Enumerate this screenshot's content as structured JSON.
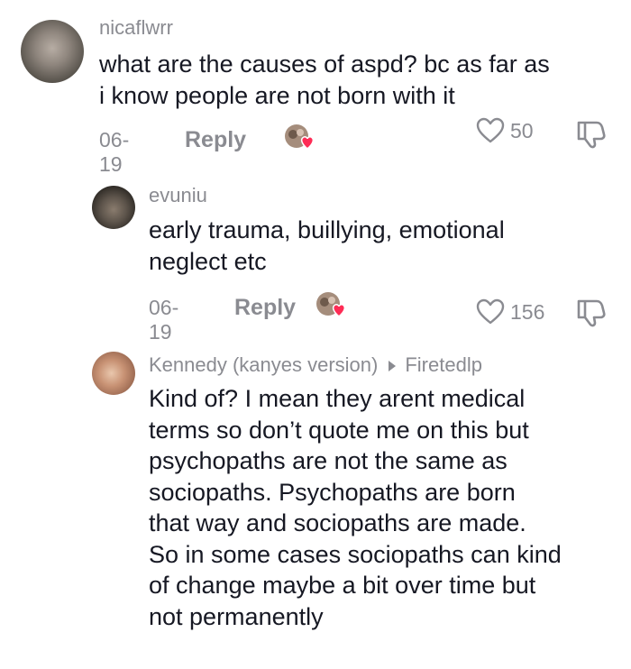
{
  "comments": [
    {
      "username": "nicaflwrr",
      "lines": [
        "what are the causes of aspd? bc as far as",
        "i know people are not born with it"
      ],
      "date": "06-19",
      "reply_label": "Reply",
      "likes": "50"
    },
    {
      "username": "evuniu",
      "lines": [
        "early trauma, buillying, emotional",
        "neglect etc"
      ],
      "date": "06-19",
      "reply_label": "Reply",
      "likes": "156"
    },
    {
      "username": "Kennedy (kanyes version)",
      "reply_to": "Firetedlp",
      "lines": [
        "Kind of? I mean they arent medical",
        "terms so don’t quote me on this but",
        "psychopaths are not the same as",
        "sociopaths. Psychopaths are born",
        "that way and sociopaths are made.",
        "So in some cases sociopaths can kind",
        "of change maybe a bit over time but",
        "not permanently"
      ]
    }
  ],
  "icons": {
    "like": "heart-outline-icon",
    "dislike": "thumbs-down-icon",
    "creator_liked": "creator-liked-avatar-heart-icon",
    "reply_arrow": "triangle-right-icon"
  },
  "colors": {
    "text": "#161823",
    "muted": "#8a8b91",
    "heart_badge": "#fe2c55"
  }
}
